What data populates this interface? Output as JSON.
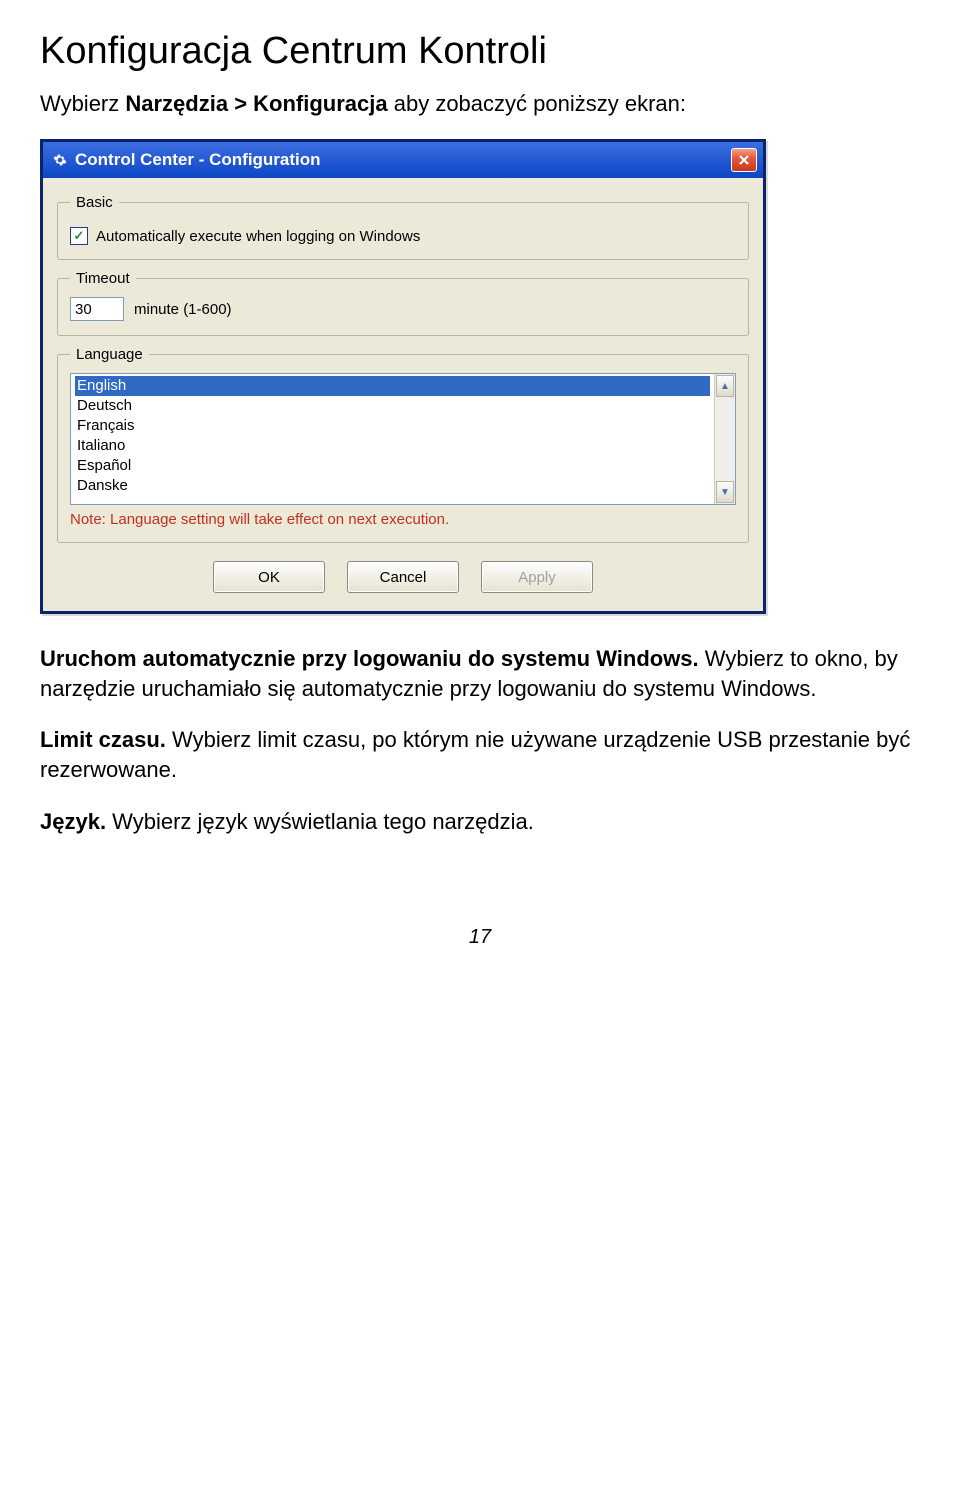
{
  "heading": "Konfiguracja Centrum Kontroli",
  "intro_prefix": "Wybierz ",
  "intro_bold": "Narzędzia > Konfiguracja",
  "intro_suffix": " aby zobaczyć poniższy ekran:",
  "dialog": {
    "title": "Control Center - Configuration",
    "basic": {
      "legend": "Basic",
      "auto_label": "Automatically execute when logging on Windows",
      "auto_checked": true
    },
    "timeout": {
      "legend": "Timeout",
      "value": "30",
      "unit_label": "minute (1-600)"
    },
    "language": {
      "legend": "Language",
      "items": [
        "English",
        "Deutsch",
        "Français",
        "Italiano",
        "Español",
        "Danske"
      ],
      "selected_index": 0,
      "note": "Note: Language setting will take effect on next execution."
    },
    "buttons": {
      "ok": "OK",
      "cancel": "Cancel",
      "apply": "Apply"
    }
  },
  "body": {
    "p1_bold": "Uruchom automatycznie przy logowaniu do systemu Windows.",
    "p1_rest": " Wybierz to okno, by narzędzie uruchamiało się automatycznie przy logowaniu do systemu Windows.",
    "p2_bold": "Limit czasu.",
    "p2_rest": " Wybierz limit czasu, po którym nie używane urządzenie USB przestanie być rezerwowane.",
    "p3_bold": "Język.",
    "p3_rest": " Wybierz język wyświetlania tego narzędzia."
  },
  "page_number": "17"
}
